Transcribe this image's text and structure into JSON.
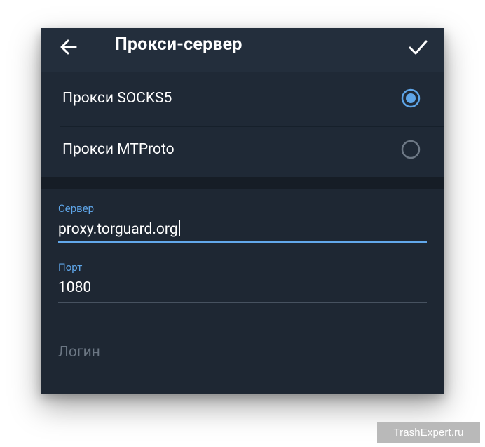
{
  "toolbar": {
    "title": "Прокси-сервер",
    "back_icon": "arrow-left-icon",
    "confirm_icon": "check-icon"
  },
  "proxy_types": {
    "options": [
      {
        "label": "Прокси SOCKS5",
        "selected": true
      },
      {
        "label": "Прокси MTProto",
        "selected": false
      }
    ]
  },
  "fields": {
    "server": {
      "label": "Сервер",
      "value": "proxy.torguard.org"
    },
    "port": {
      "label": "Порт",
      "value": "1080"
    },
    "login": {
      "placeholder": "Логин",
      "value": ""
    }
  },
  "watermark": "TrashExpert.ru",
  "colors": {
    "background": "#1e2733",
    "toolbar": "#232e3c",
    "accent": "#5ea5e8",
    "text": "#ffffff",
    "hint": "#6b7683"
  }
}
